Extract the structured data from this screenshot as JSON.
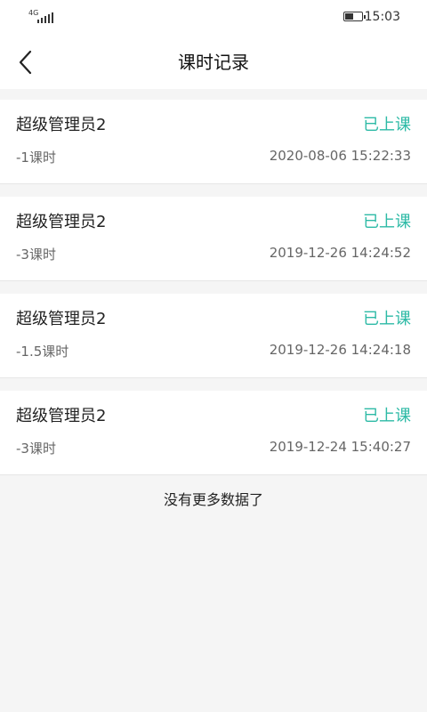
{
  "status_bar": {
    "network": "4G",
    "time": "15:03"
  },
  "header": {
    "title": "课时记录"
  },
  "records": [
    {
      "name": "超级管理员2",
      "status": "已上课",
      "hours": "-1课时",
      "timestamp": "2020-08-06 15:22:33"
    },
    {
      "name": "超级管理员2",
      "status": "已上课",
      "hours": "-3课时",
      "timestamp": "2019-12-26 14:24:52"
    },
    {
      "name": "超级管理员2",
      "status": "已上课",
      "hours": "-1.5课时",
      "timestamp": "2019-12-26 14:24:18"
    },
    {
      "name": "超级管理员2",
      "status": "已上课",
      "hours": "-3课时",
      "timestamp": "2019-12-24 15:40:27"
    }
  ],
  "footer": {
    "no_more_text": "没有更多数据了"
  },
  "colors": {
    "accent": "#2dbaa6",
    "background": "#f5f5f5"
  }
}
